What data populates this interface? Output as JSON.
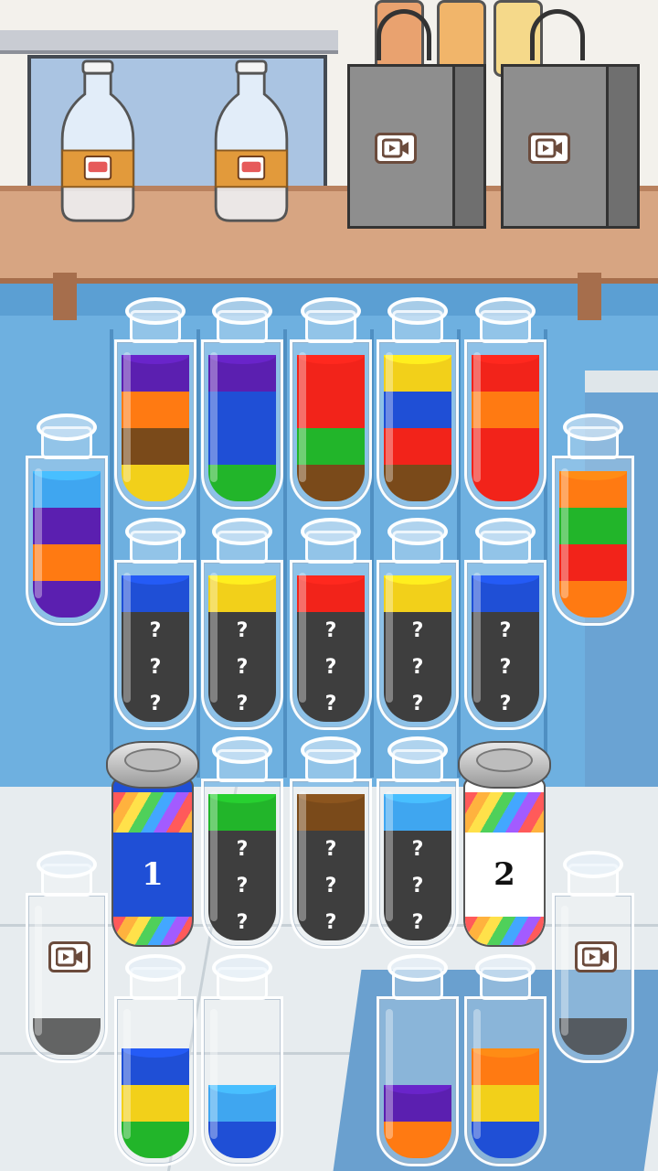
{
  "colors": {
    "purple": "#5b1fb0",
    "orange": "#ff7a12",
    "brown": "#7a4a1a",
    "yellow": "#f2d01a",
    "blue": "#1f4fd6",
    "green": "#22b52a",
    "red": "#f2231a",
    "lightblue": "#3fa6f0",
    "hidden": "#3e3e3e"
  },
  "shelf": {
    "bottles": [
      {
        "icon": "meat-label-icon"
      },
      {
        "icon": "meat-label-icon"
      }
    ],
    "bags": [
      {
        "icon": "video-ad-icon"
      },
      {
        "icon": "video-ad-icon"
      }
    ]
  },
  "hidden_mark": "?",
  "tubes": [
    {
      "id": "t1",
      "layers": [
        "yellow",
        "brown",
        "orange",
        "purple"
      ]
    },
    {
      "id": "t2",
      "layers": [
        "green",
        "blue",
        "blue",
        "purple"
      ]
    },
    {
      "id": "t3",
      "layers": [
        "brown",
        "green",
        "red",
        "red"
      ]
    },
    {
      "id": "t4",
      "layers": [
        "brown",
        "red",
        "blue",
        "yellow"
      ]
    },
    {
      "id": "t5",
      "layers": [
        "red",
        "red",
        "orange",
        "red"
      ]
    },
    {
      "id": "t6",
      "layers": [
        "purple",
        "orange",
        "purple",
        "lightblue"
      ]
    },
    {
      "id": "t7",
      "layers": [
        "orange",
        "red",
        "green",
        "orange"
      ]
    },
    {
      "id": "t8",
      "layers": [
        "hidden",
        "hidden",
        "hidden",
        "blue"
      ]
    },
    {
      "id": "t9",
      "layers": [
        "hidden",
        "hidden",
        "hidden",
        "yellow"
      ]
    },
    {
      "id": "t10",
      "layers": [
        "hidden",
        "hidden",
        "hidden",
        "red"
      ]
    },
    {
      "id": "t11",
      "layers": [
        "hidden",
        "hidden",
        "hidden",
        "yellow"
      ]
    },
    {
      "id": "t12",
      "layers": [
        "hidden",
        "hidden",
        "hidden",
        "blue"
      ]
    },
    {
      "id": "t13",
      "layers": [
        "hidden",
        "hidden",
        "hidden",
        "green"
      ]
    },
    {
      "id": "t14",
      "layers": [
        "hidden",
        "hidden",
        "hidden",
        "brown"
      ]
    },
    {
      "id": "t15",
      "layers": [
        "hidden",
        "hidden",
        "hidden",
        "lightblue"
      ]
    },
    {
      "id": "t16",
      "layers": [],
      "locked_ad": true
    },
    {
      "id": "t17",
      "layers": [],
      "locked_ad": true
    },
    {
      "id": "t18",
      "layers": [
        "green",
        "yellow",
        "blue"
      ]
    },
    {
      "id": "t19",
      "layers": [
        "blue",
        "lightblue"
      ]
    },
    {
      "id": "t20",
      "layers": [
        "orange",
        "purple"
      ]
    },
    {
      "id": "t21",
      "layers": [
        "blue",
        "yellow",
        "orange"
      ]
    }
  ],
  "cans": [
    {
      "id": "c1",
      "number": "1",
      "color": "blue"
    },
    {
      "id": "c2",
      "number": "2",
      "color": "white"
    }
  ],
  "ad_icon": "video-ad-icon"
}
